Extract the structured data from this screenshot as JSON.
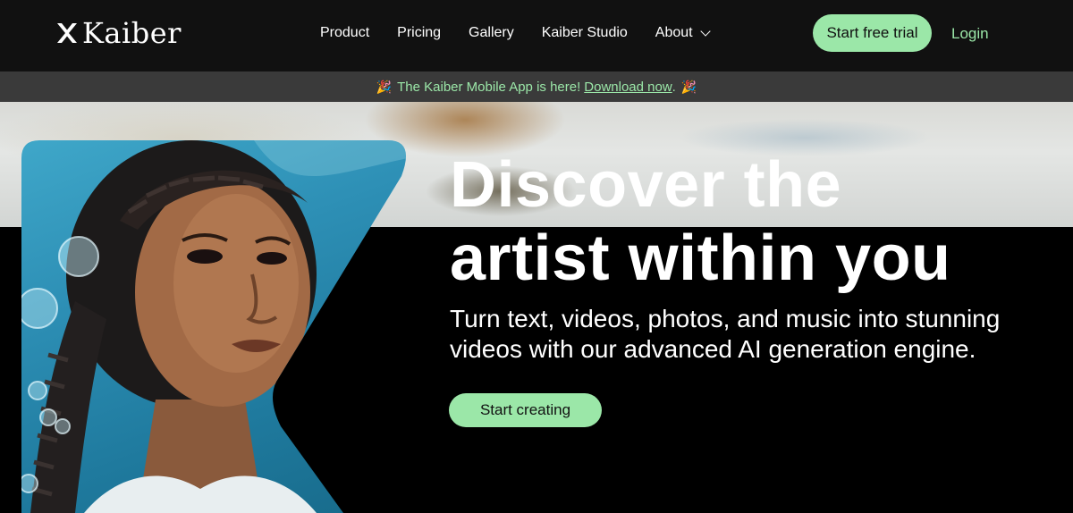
{
  "brand": {
    "name": "Kaiber",
    "icon": "kaiber-logo-icon"
  },
  "nav": {
    "links": [
      "Product",
      "Pricing",
      "Gallery",
      "Kaiber Studio",
      "About"
    ],
    "cta_label": "Start free trial",
    "login_label": "Login"
  },
  "announcement": {
    "prefix": "The Kaiber Mobile App is here!",
    "link_text": "Download now",
    "suffix": ".",
    "emoji": "🎉"
  },
  "hero": {
    "headline_line1": "Discover the",
    "headline_line2": "artist within you",
    "subheading": "Turn text, videos, photos, and music into stunning videos with our advanced AI generation engine.",
    "cta_label": "Start creating",
    "image": "ai-portrait-illustration"
  },
  "colors": {
    "accent": "#9be7a8",
    "nav_bg": "#111111",
    "announce_bg": "#3a3a3a"
  }
}
